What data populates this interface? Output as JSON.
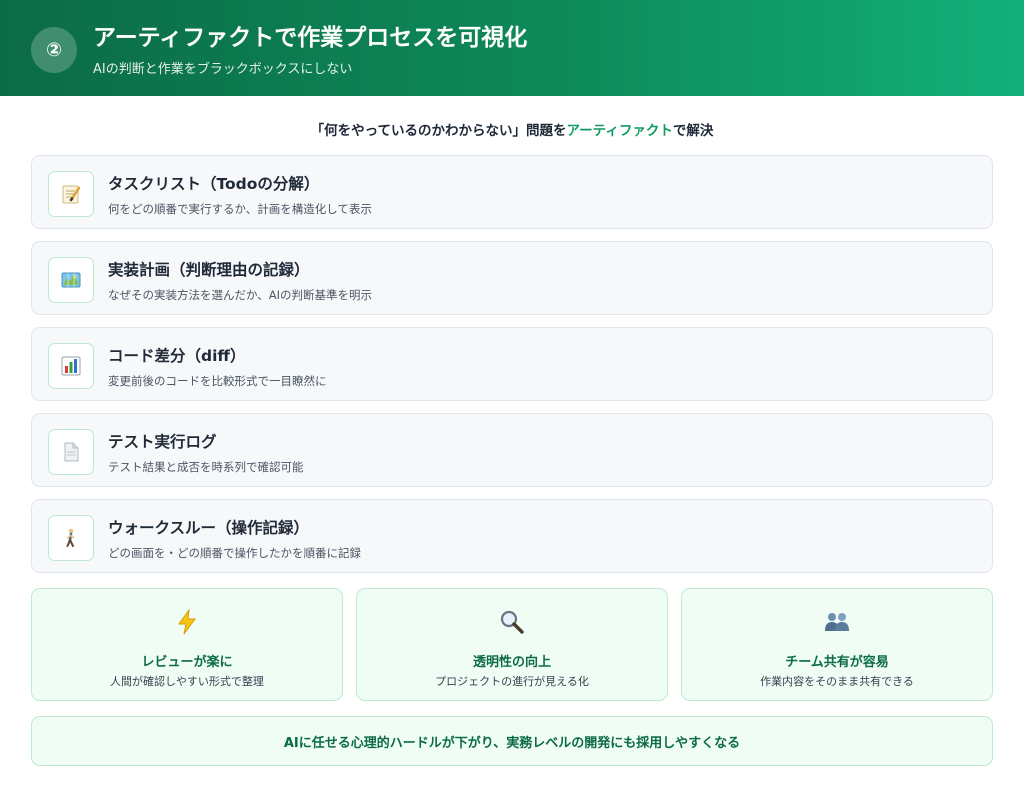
{
  "header": {
    "badge": "②",
    "title": "アーティファクトで作業プロセスを可視化",
    "subtitle": "AIの判断と作業をブラックボックスにしない"
  },
  "lead": {
    "prefix": "「何をやっているのかわからない」問題を",
    "highlight": "アーティファクト",
    "suffix": "で解決"
  },
  "artifacts": [
    {
      "icon": "memo-icon",
      "title": "タスクリスト（Todoの分解）",
      "desc": "何をどの順番で実行するか、計画を構造化して表示"
    },
    {
      "icon": "map-icon",
      "title": "実装計画（判断理由の記録）",
      "desc": "なぜその実装方法を選んだか、AIの判断基準を明示"
    },
    {
      "icon": "bar-chart-icon",
      "title": "コード差分（diff）",
      "desc": "変更前後のコードを比較形式で一目瞭然に"
    },
    {
      "icon": "document-icon",
      "title": "テスト実行ログ",
      "desc": "テスト結果と成否を時系列で確認可能"
    },
    {
      "icon": "walking-person-icon",
      "title": "ウォークスルー（操作記録）",
      "desc": "どの画面を・どの順番で操作したかを順番に記録"
    }
  ],
  "benefits": [
    {
      "icon": "lightning-icon",
      "title": "レビューが楽に",
      "desc": "人間が確認しやすい形式で整理"
    },
    {
      "icon": "magnifier-icon",
      "title": "透明性の向上",
      "desc": "プロジェクトの進行が見える化"
    },
    {
      "icon": "people-icon",
      "title": "チーム共有が容易",
      "desc": "作業内容をそのまま共有できる"
    }
  ],
  "footer": "AIに任せる心理的ハードルが下がり、実務レベルの開発にも採用しやすくなる",
  "colors": {
    "header_start": "#0b6b46",
    "header_end": "#12b07a",
    "accent": "#0f9a62",
    "benefit_bg": "#f0fdf4"
  }
}
